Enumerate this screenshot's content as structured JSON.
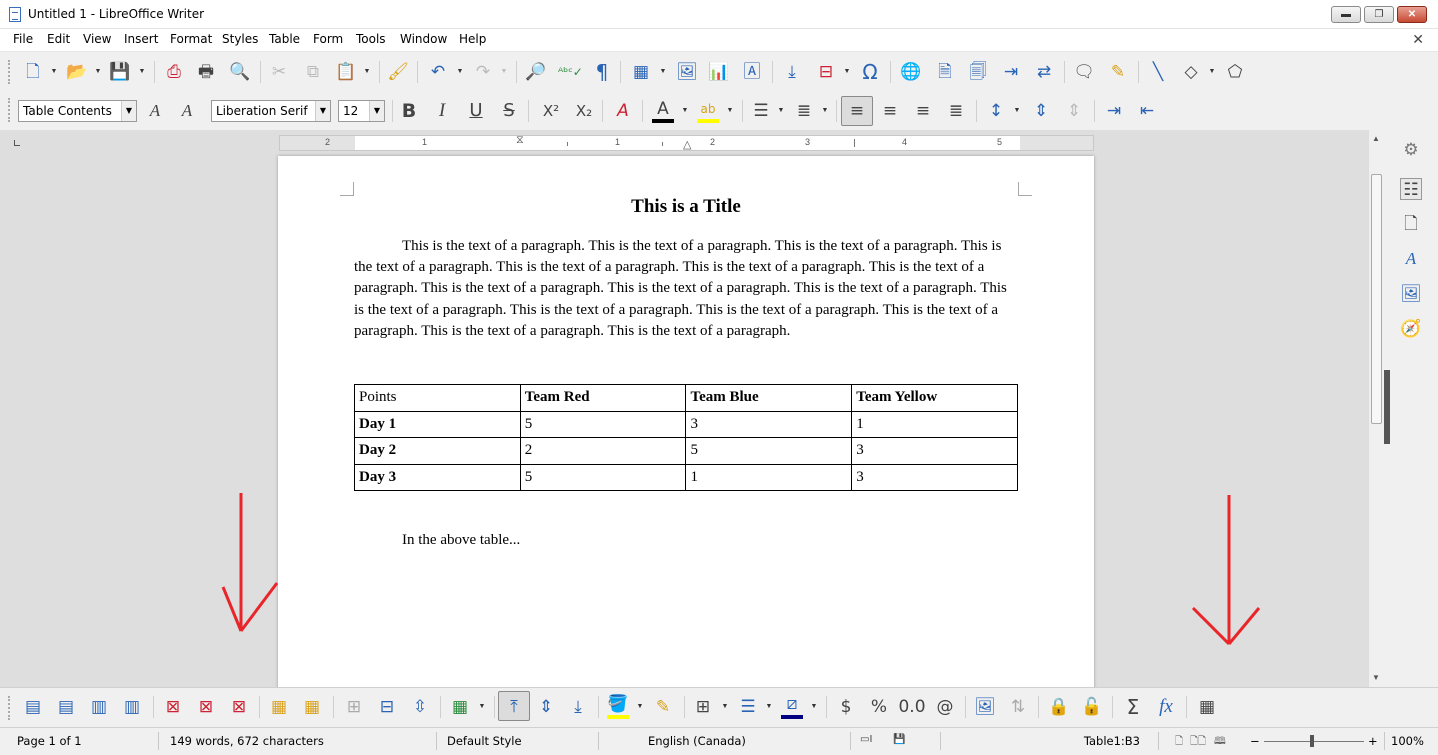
{
  "window": {
    "title": "Untitled 1 - LibreOffice Writer",
    "minimize_label": "▬",
    "restore_label": "❐",
    "close_label": "✕"
  },
  "menu": [
    "File",
    "Edit",
    "View",
    "Insert",
    "Format",
    "Styles",
    "Table",
    "Form",
    "Tools",
    "Window",
    "Help"
  ],
  "formatting": {
    "paragraph_style": "Table Contents",
    "font_name": "Liberation Serif",
    "font_size": "12"
  },
  "ruler": {
    "left_numbers": [
      "2",
      "1"
    ],
    "right_numbers": [
      "1",
      "2",
      "3",
      "4",
      "5"
    ]
  },
  "document": {
    "title": "This is a Title",
    "paragraph": "This is the text of a paragraph.  This is the text of a paragraph.  This is the text of a paragraph.  This is the text of a paragraph.  This is the text of a paragraph.  This is the text of a paragraph.  This is the text of a paragraph.  This is the text of a paragraph.  This is the text of a paragraph.  This is the text of a paragraph.  This is the text of a paragraph.  This is the text of a paragraph.  This is the text of a paragraph.  This is the text of a paragraph.  This is the text of a paragraph.  This is the text of a paragraph.",
    "table": {
      "headers": [
        "Points",
        "Team Red",
        "Team Blue",
        "Team Yellow"
      ],
      "rows": [
        [
          "Day 1",
          "5",
          "3",
          "1"
        ],
        [
          "Day 2",
          "2",
          "5",
          "3"
        ],
        [
          "Day 3",
          "5",
          "1",
          "3"
        ]
      ]
    },
    "after_table_text": "In the above table..."
  },
  "status_bar": {
    "page": "Page 1 of 1",
    "word_count": "149 words, 672 characters",
    "page_style": "Default Style",
    "language": "English (Canada)",
    "cell": "Table1:B3",
    "zoom": "100%"
  },
  "colors": {
    "annotation_arrow": "#e8262a",
    "icon_blue": "#2a64b5",
    "font_color_swatch": "#000000",
    "highlight_swatch": "#ffff00"
  }
}
